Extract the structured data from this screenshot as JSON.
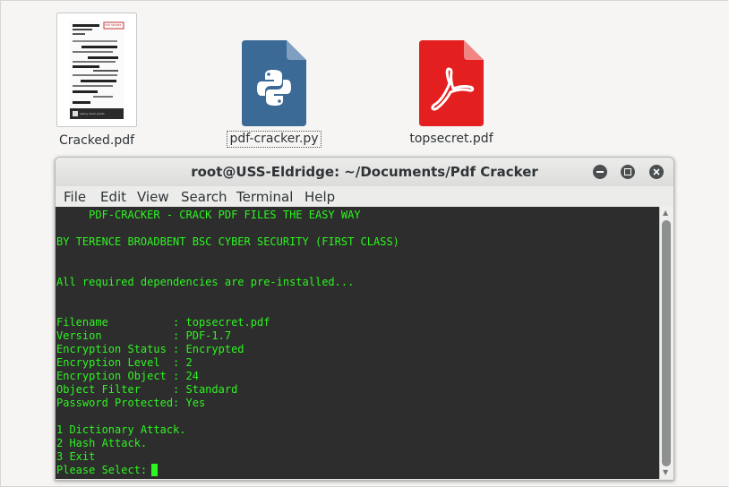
{
  "desktop": {
    "files": [
      {
        "name": "Cracked.pdf",
        "type": "pdf-thumbnail"
      },
      {
        "name": "pdf-cracker.py",
        "type": "python"
      },
      {
        "name": "topsecret.pdf",
        "type": "pdf"
      }
    ],
    "thumbnail_stamp": "TOP SECRET",
    "watermark": "alamy stock photo"
  },
  "terminal": {
    "title": "root@USS-Eldridge: ~/Documents/Pdf Cracker",
    "menu": [
      "File",
      "Edit",
      "View",
      "Search",
      "Terminal",
      "Help"
    ],
    "lines": [
      "     PDF-CRACKER - CRACK PDF FILES THE EASY WAY",
      "",
      "BY TERENCE BROADBENT BSC CYBER SECURITY (FIRST CLASS)",
      "",
      "",
      "All required dependencies are pre-installed...",
      "",
      "",
      "Filename          : topsecret.pdf",
      "Version           : PDF-1.7",
      "Encryption Status : Encrypted",
      "Encryption Level  : 2",
      "Encryption Object : 24",
      "Object Filter     : Standard",
      "Password Protected: Yes",
      "",
      "1 Dictionary Attack.",
      "2 Hash Attack.",
      "3 Exit",
      "Please Select: "
    ],
    "text_color": "#2df51f",
    "background_color": "#2d2d2d"
  }
}
